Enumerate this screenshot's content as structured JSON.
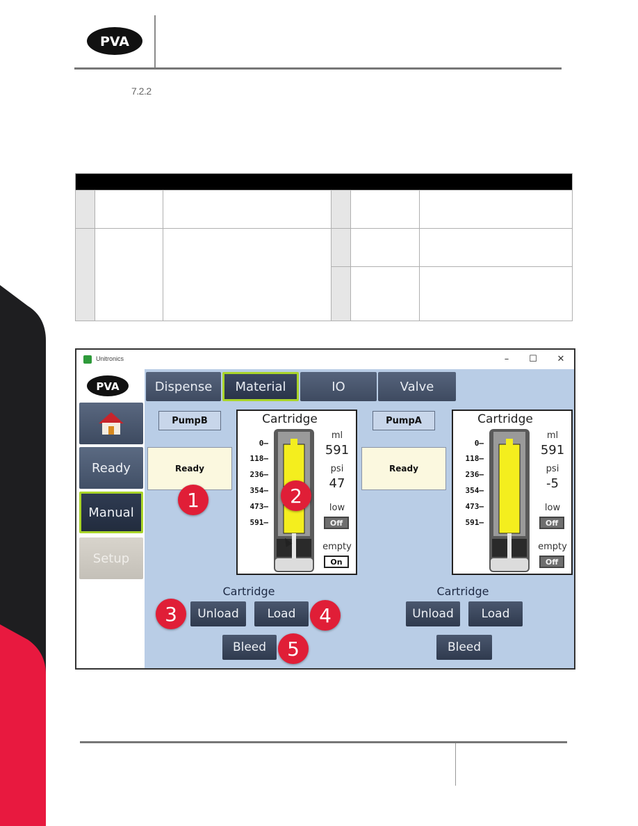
{
  "document": {
    "brand": "PVA",
    "section_number": "7.2.2",
    "colors": {
      "brand_red": "#e8193f",
      "band_black": "#1e1e20",
      "active_outline": "#a9d42a",
      "screen_bg": "#b9cde6",
      "callout_red": "#e01e37"
    }
  },
  "table": {
    "rows": [
      {
        "num": "",
        "name": "",
        "desc": "",
        "num2": "",
        "name2": "",
        "desc2": ""
      },
      {
        "num": "",
        "name": "",
        "desc": "",
        "num2": "",
        "name2": "",
        "desc2": ""
      },
      {
        "num2": "",
        "name2": "",
        "desc2": ""
      }
    ]
  },
  "window": {
    "title": "Unitronics",
    "controls": {
      "minimize": "–",
      "maximize": "☐",
      "close": "✕"
    },
    "logo": "PVA",
    "nav": {
      "home_icon": "home-icon",
      "ready": "Ready",
      "manual": "Manual",
      "setup": "Setup",
      "active": "Manual"
    },
    "tabs": [
      {
        "label": "Dispense"
      },
      {
        "label": "Material",
        "active": true
      },
      {
        "label": "IO"
      },
      {
        "label": "Valve"
      }
    ],
    "pumps": [
      {
        "name": "PumpB",
        "status": "Ready",
        "cartridge": {
          "title": "Cartridge",
          "scale": [
            "0–",
            "118–",
            "236–",
            "354–",
            "473–",
            "591–"
          ],
          "ml_label": "ml",
          "ml_value": "591",
          "psi_label": "psi",
          "psi_value": "47",
          "low_label": "low",
          "low_state": "Off",
          "empty_label": "empty",
          "empty_state": "On",
          "fill_fraction": 1.0
        },
        "ops": {
          "label": "Cartridge",
          "unload": "Unload",
          "load": "Load",
          "bleed": "Bleed"
        }
      },
      {
        "name": "PumpA",
        "status": "Ready",
        "cartridge": {
          "title": "Cartridge",
          "scale": [
            "0–",
            "118–",
            "236–",
            "354–",
            "473–",
            "591–"
          ],
          "ml_label": "ml",
          "ml_value": "591",
          "psi_label": "psi",
          "psi_value": "-5",
          "low_label": "low",
          "low_state": "Off",
          "empty_label": "empty",
          "empty_state": "Off",
          "fill_fraction": 1.0
        },
        "ops": {
          "label": "Cartridge",
          "unload": "Unload",
          "load": "Load",
          "bleed": "Bleed"
        }
      }
    ],
    "callouts": [
      "1",
      "2",
      "3",
      "4",
      "5"
    ]
  }
}
